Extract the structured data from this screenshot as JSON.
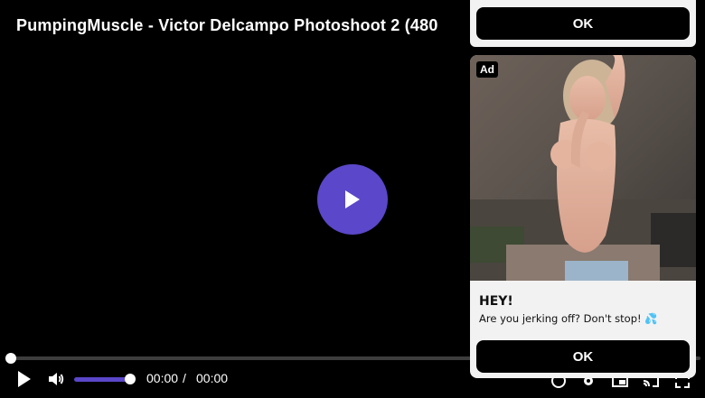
{
  "player": {
    "title": "PumpingMuscle - Victor Delcampo Photoshoot 2 (480",
    "accent_color": "#5a47c9",
    "current_time": "00:00",
    "separator": "/",
    "duration": "00:00",
    "progress": 0,
    "volume": 1.0,
    "icons": {
      "big_play": "play-icon",
      "play": "play-icon",
      "volume": "volume-icon",
      "right": [
        "chromecast-icon",
        "settings-icon",
        "miniplayer-icon",
        "cast-icon",
        "fullscreen-icon"
      ]
    }
  },
  "ad": {
    "top_ok_label": "OK",
    "badge": "Ad",
    "headline": "HEY!",
    "body": "Are you jerking off? Don't stop! 💦",
    "ok_label": "OK"
  }
}
